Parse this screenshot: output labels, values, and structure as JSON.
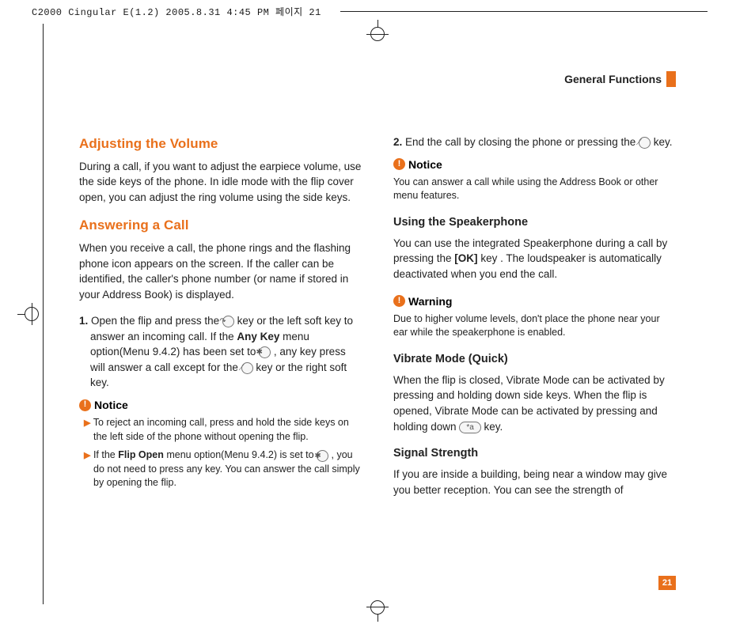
{
  "doc_header": "C2000 Cingular  E(1.2)  2005.8.31 4:45 PM  페이지 21",
  "chapter_title": "General Functions",
  "page_number": "21",
  "left": {
    "h1": "Adjusting the Volume",
    "p1": "During a call, if you want to adjust the earpiece volume, use the side keys of the phone. In idle mode with the flip cover open, you can adjust the ring volume using the side keys.",
    "h2": "Answering a Call",
    "p2": "When you receive a call, the phone rings and the flashing phone icon appears on the screen. If the caller can be identified, the caller's phone number (or name if stored in your Address Book) is displayed.",
    "li1_num": "1.",
    "li1_a": "Open the flip and press the ",
    "li1_key1": "↷",
    "li1_b": " key or the left soft key to answer an incoming call. If the ",
    "li1_bold": "Any Key",
    "li1_c": " menu option(Menu 9.4.2) has been set to  ",
    "li1_key2": "✱",
    "li1_d": " , any key press will answer a call except for the ",
    "li1_key3": "⟋",
    "li1_e": " key or the right soft key.",
    "notice_label": "Notice",
    "n1_a": "To reject an incoming call, press and hold the side keys on the left side of the phone without opening the flip.",
    "n2_a": "If the ",
    "n2_bold": "Flip Open",
    "n2_b": " menu option(Menu 9.4.2) is set to  ",
    "n2_key": "✱",
    "n2_c": " , you do not need to press any key. You can answer the call simply by opening the flip."
  },
  "right": {
    "li2_num": "2.",
    "li2_a": "End the call by closing the phone or pressing the ",
    "li2_key": "⟋",
    "li2_b": " key.",
    "notice_label": "Notice",
    "notice_body": "You can answer a call while using the Address Book or other menu features.",
    "h1": "Using the Speakerphone",
    "p1_a": "You can use the integrated Speakerphone during a call by pressing the ",
    "p1_bold": "[OK]",
    "p1_b": " key . The loudspeaker is automatically deactivated when you end the call.",
    "warning_label": "Warning",
    "warning_body": "Due to higher volume levels, don't place the phone near your ear while the speakerphone is enabled.",
    "h2": "Vibrate Mode (Quick)",
    "p2_a": "When the flip is closed, Vibrate Mode can be activated by pressing and holding down side keys. When the flip is opened, Vibrate Mode can be activated by pressing and holding down  ",
    "p2_key": "*a",
    "p2_b": " key.",
    "h3": "Signal Strength",
    "p3": "If you are inside a building, being near a window may give you better reception. You can see the strength of"
  }
}
